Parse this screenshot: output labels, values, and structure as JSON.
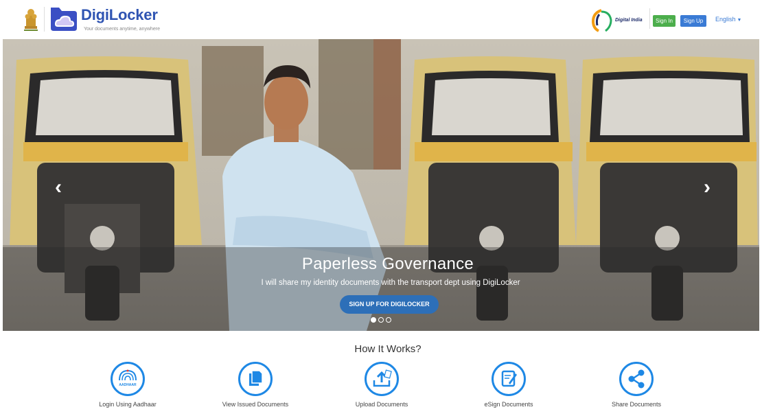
{
  "header": {
    "brand": "DigiLocker",
    "tagline": "Your documents anytime, anywhere",
    "digital_india": "Digital India",
    "signin_label": "Sign In",
    "signup_label": "Sign Up",
    "language": "English"
  },
  "hero": {
    "title": "Paperless Governance",
    "subtitle": "I will share my identity documents with the transport dept using DigiLocker",
    "cta_label": "SIGN UP FOR DIGILOCKER",
    "slide_count": 3,
    "active_slide": 1
  },
  "how": {
    "title": "How It Works?",
    "steps": [
      {
        "label": "Login Using Aadhaar",
        "icon": "aadhaar-icon"
      },
      {
        "label": "View Issued Documents",
        "icon": "documents-icon"
      },
      {
        "label": "Upload Documents",
        "icon": "upload-icon"
      },
      {
        "label": "eSign Documents",
        "icon": "esign-icon"
      },
      {
        "label": "Share Documents",
        "icon": "share-icon"
      }
    ],
    "aadhaar_badge": "AADHAAR"
  },
  "colors": {
    "brand_blue": "#2f54b2",
    "signin_green": "#4cae4c",
    "signup_blue": "#3a7bd5",
    "step_blue": "#1e88e5"
  }
}
